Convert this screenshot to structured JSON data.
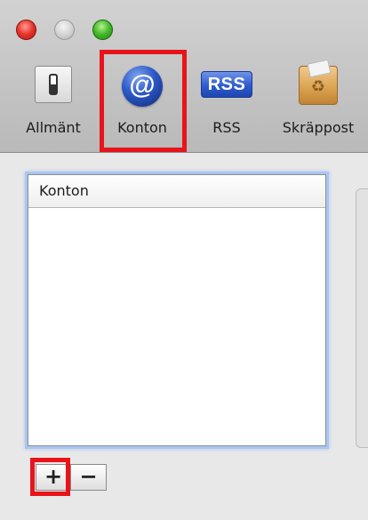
{
  "window": {
    "toolbar": {
      "items": [
        {
          "id": "general",
          "label": "Allmänt",
          "icon": "switch-icon"
        },
        {
          "id": "accounts",
          "label": "Konton",
          "icon": "at-icon",
          "icon_text": "@",
          "highlighted": true
        },
        {
          "id": "rss",
          "label": "RSS",
          "icon": "rss-icon",
          "icon_text": "RSS"
        },
        {
          "id": "junk",
          "label": "Skräppost",
          "icon": "junk-icon"
        }
      ]
    }
  },
  "accounts_list": {
    "header": "Konton",
    "rows": []
  },
  "list_buttons": {
    "add": "+",
    "remove": "−"
  },
  "colors": {
    "highlight": "#e8141a",
    "focus_ring": "#a9c6f1"
  }
}
